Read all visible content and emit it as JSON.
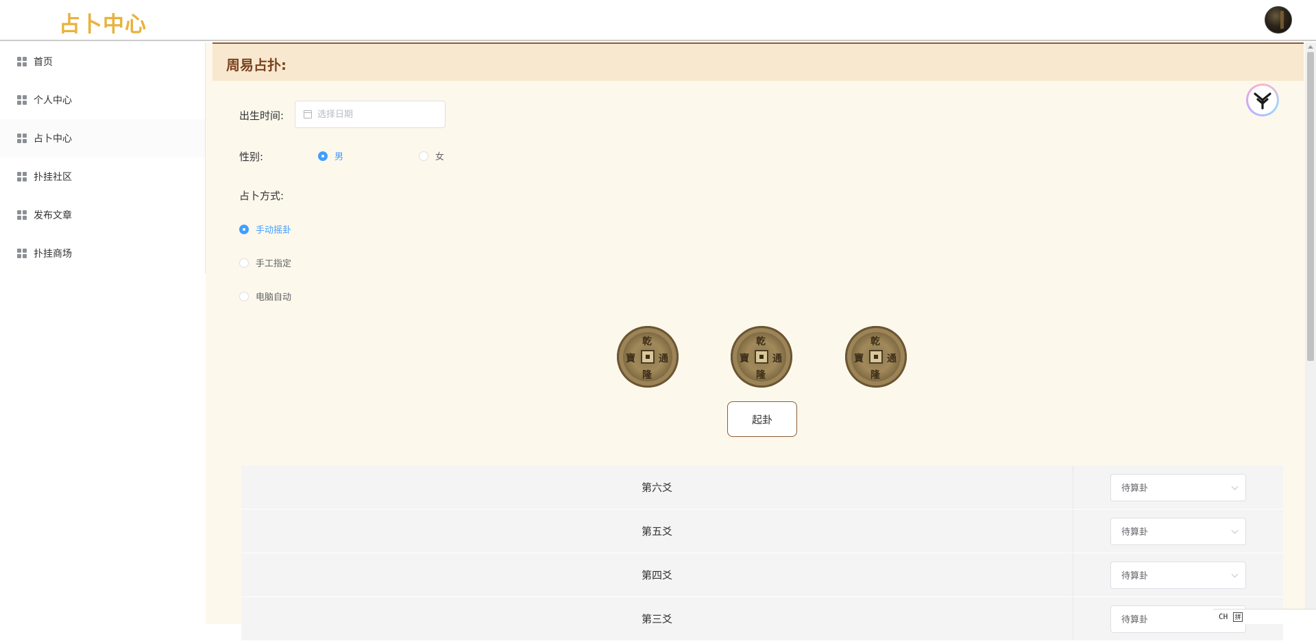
{
  "header": {
    "logo": "占卜中心"
  },
  "sidebar": {
    "items": [
      {
        "label": "首页"
      },
      {
        "label": "个人中心"
      },
      {
        "label": "占卜中心"
      },
      {
        "label": "扑挂社区"
      },
      {
        "label": "发布文章"
      },
      {
        "label": "扑挂商场"
      }
    ]
  },
  "main": {
    "title": "周易占扑:",
    "form": {
      "birth_label": "出生时间:",
      "birth_placeholder": "选择日期",
      "gender_label": "性别:",
      "gender_options": [
        "男",
        "女"
      ],
      "gender_selected": "男",
      "method_label": "占卜方式:",
      "method_options": [
        "手动摇卦",
        "手工指定",
        "电脑自动"
      ],
      "method_selected": "手动摇卦"
    },
    "coins": [
      "coin-1",
      "coin-2",
      "coin-3"
    ],
    "cast_button": "起卦",
    "yao_rows": [
      {
        "name": "第六爻",
        "value": "待算卦"
      },
      {
        "name": "第五爻",
        "value": "待算卦"
      },
      {
        "name": "第四爻",
        "value": "待算卦"
      },
      {
        "name": "第三爻",
        "value": "待算卦"
      }
    ]
  },
  "ime": {
    "lang": "CH",
    "mode": "拼"
  },
  "colors": {
    "logo": "#e9b23c",
    "title": "#7a4220",
    "accent": "#409eff",
    "page_bg": "#fdf8ec",
    "topbar_bg": "#f8e8cf"
  }
}
